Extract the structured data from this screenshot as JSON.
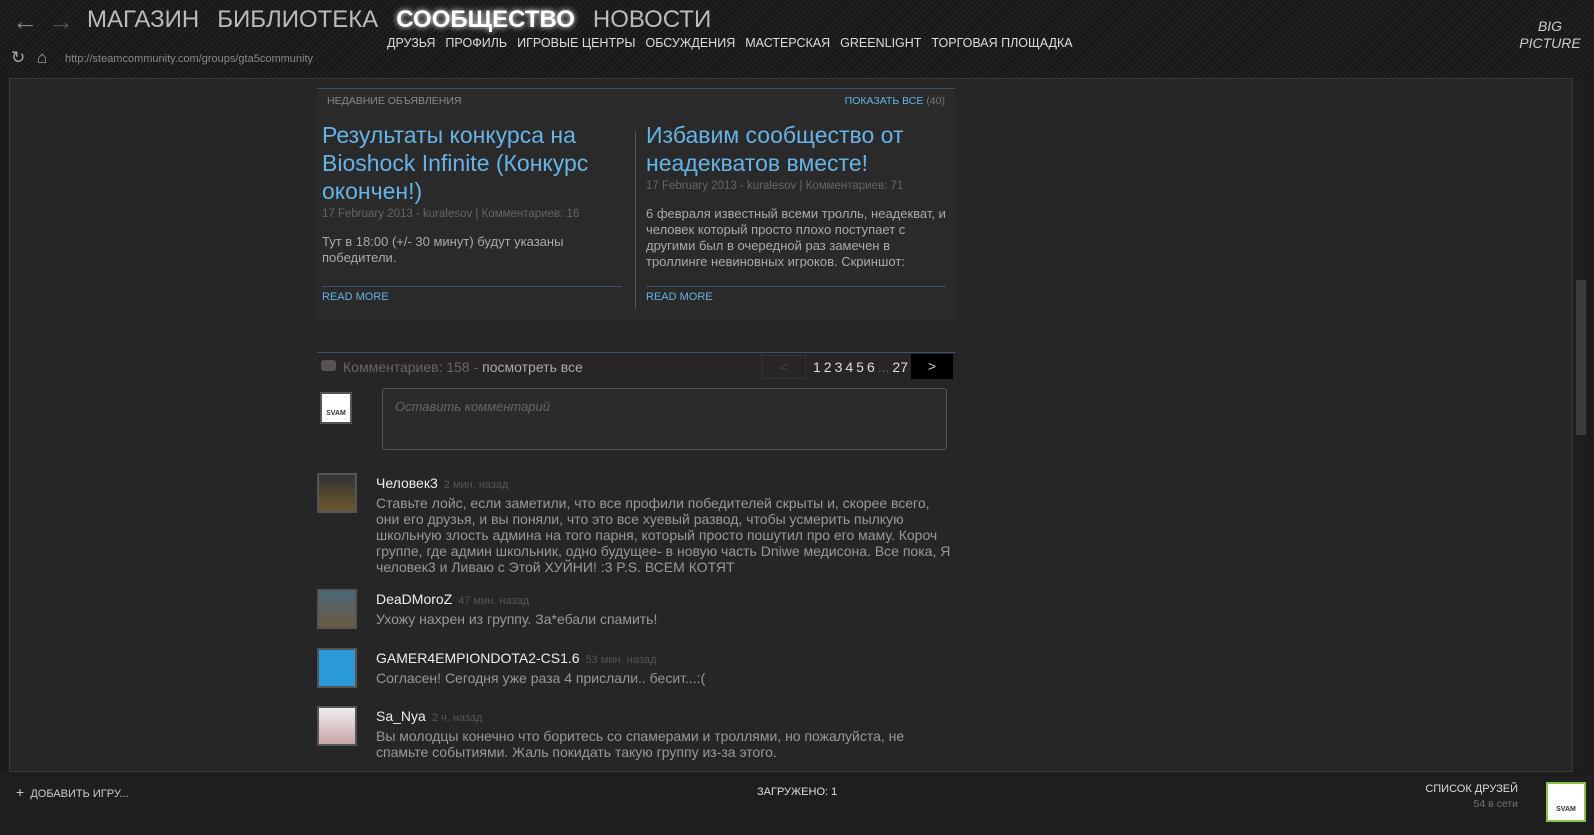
{
  "nav": {
    "main": [
      "МАГАЗИН",
      "БИБЛИОТЕКА",
      "СООБЩЕСТВО",
      "НОВОСТИ"
    ],
    "sub": [
      "ДРУЗЬЯ",
      "ПРОФИЛЬ",
      "ИГРОВЫЕ ЦЕНТРЫ",
      "ОБСУЖДЕНИЯ",
      "МАСТЕРСКАЯ",
      "GREENLIGHT",
      "ТОРГОВАЯ ПЛОЩАДКА"
    ],
    "url": "http://steamcommunity.com/groups/gta5community",
    "big_picture": "BIG PICTURE"
  },
  "announcements": {
    "header": "НЕДАВНИЕ ОБЪЯВЛЕНИЯ",
    "show_all": "ПОКАЗАТЬ ВСЕ",
    "count": "(40)",
    "items": [
      {
        "title": "Результаты конкурса на Bioshock Infinite (Конкурс окончен!)",
        "meta": "17 February 2013 - kuralesov | Комментариев: 16",
        "body": "Тут в 18:00 (+/- 30 минут) будут указаны победители.",
        "read_more": "READ MORE"
      },
      {
        "title": "Избавим сообщество от неадекватов вместе!",
        "meta": "17 February 2013 - kuralesov | Комментариев: 71",
        "body": "6 февраля известный всеми тролль, неадекват, и человек который просто плохо поступает с другими был в очередной раз замечен в троллинге невиновных игроков. Скриншот:",
        "read_more": "READ MORE"
      }
    ]
  },
  "comments": {
    "count_label": "Комментариев: 158 -",
    "view_all": "посмотреть все",
    "pages": [
      "<",
      "1",
      "2",
      "3",
      "4",
      "5",
      "6",
      "...",
      "27",
      ">"
    ],
    "placeholder": "Оставить комментарий",
    "avatar_text": "SVAM",
    "items": [
      {
        "name": "Человек3",
        "time": "2 мин. назад",
        "text": "Ставьте лойс, если заметили, что все профили победителей скрыты и, скорее всего, они его друзья, и вы поняли, что это все хуевый развод, чтобы усмерить пылкую школьную злость админа на того парня, который просто пошутил про его маму. Короч группе, где админ школьник, одно будущее- в новую часть Dniwe медисона. Все пока, Я человек3 и Ливаю с Этой ХУЙНИ! :3 P.S. ВСЕМ КОТЯТ"
      },
      {
        "name": "DeaDMoroZ",
        "time": "47 мин. назад",
        "text": "Ухожу нахрен из группу. За*ебали спамить!"
      },
      {
        "name": "GAMER4EMPIONDOTA2-CS1.6",
        "time": "53 мин. назад",
        "text": "Согласен! Сегодня уже раза 4 прислали.. бесит...:("
      },
      {
        "name": "Sa_Nya",
        "time": "2 ч. назад",
        "text": "Вы молодцы конечно что боритесь со спамерами и троллями, но пожалуйста, не спамьте событиями. Жаль покидать такую группу из-за этого."
      }
    ]
  },
  "footer": {
    "add_game": "ДОБАВИТЬ ИГРУ...",
    "loaded": "ЗАГРУЖЕНО: 1",
    "friends": "СПИСОК ДРУЗЕЙ",
    "online": "54 в сети"
  }
}
